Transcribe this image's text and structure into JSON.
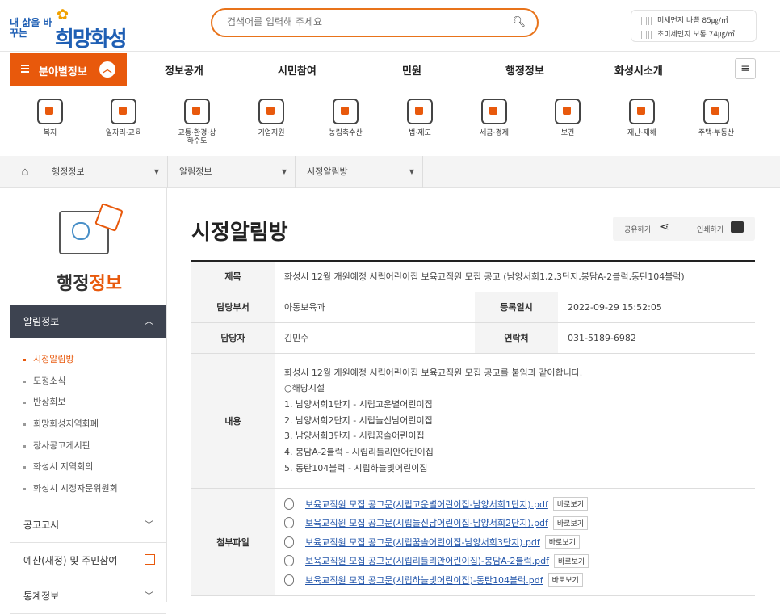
{
  "logo": {
    "small_text": "내 삶을 바꾸는",
    "big_text": "희망화성"
  },
  "search": {
    "placeholder": "검색어를 입력해 주세요"
  },
  "dust": {
    "pm10": "미세먼지 나쁨 85㎍/㎥",
    "pm25": "초미세먼지 보통 74㎍/㎥"
  },
  "nav": {
    "field_button": "분야별정보",
    "items": [
      "정보공개",
      "시민참여",
      "민원",
      "행정정보",
      "화성시소개"
    ]
  },
  "categories": [
    {
      "label": "복지",
      "icon": "handshake-icon"
    },
    {
      "label": "일자리·교육",
      "icon": "graduation-cap-icon"
    },
    {
      "label": "교통·환경·상하수도",
      "icon": "car-icon"
    },
    {
      "label": "기업지원",
      "icon": "businessman-icon"
    },
    {
      "label": "농림축수산",
      "icon": "farm-tools-icon"
    },
    {
      "label": "법·제도",
      "icon": "gavel-icon"
    },
    {
      "label": "세금·경제",
      "icon": "bar-chart-icon"
    },
    {
      "label": "보건",
      "icon": "first-aid-icon"
    },
    {
      "label": "재난·재해",
      "icon": "storm-cloud-icon"
    },
    {
      "label": "주택·부동산",
      "icon": "building-icon"
    }
  ],
  "breadcrumb": [
    "행정정보",
    "알림정보",
    "시정알림방"
  ],
  "sidebar": {
    "title_a": "행정",
    "title_b": "정보",
    "open_section": "알림정보",
    "sub_items": [
      "시정알림방",
      "도정소식",
      "반상회보",
      "희망화성지역화폐",
      "장사공고게시판",
      "화성시 지역회의",
      "화성시 시정자문위원회"
    ],
    "menus": [
      "공고고시",
      "예산(재정) 및 주민참여",
      "통계정보"
    ]
  },
  "page": {
    "title": "시정알림방",
    "share": "공유하기",
    "print": "인쇄하기"
  },
  "post": {
    "label_subject": "제목",
    "subject": "화성시 12월 개원예정 시립어린이집 보육교직원 모집 공고 (남양서희1,2,3단지,봉담A-2블럭,동탄104블럭)",
    "label_dept": "담당부서",
    "dept": "아동보육과",
    "label_date": "등록일시",
    "date": "2022-09-29 15:52:05",
    "label_person": "담당자",
    "person": "김민수",
    "label_contact": "연락처",
    "contact": "031-5189-6982",
    "label_content": "내용",
    "content_lines": [
      "화성시 12월 개원예정 시립어린이집 보육교직원 모집 공고를 붙임과 같이합니다.",
      "○해당시설",
      "1. 남양서희1단지 - 시립고운별어린이집",
      "2. 남양서희2단지 - 시립늘신남어린이집",
      "3. 남양서희3단지 - 시립꿈솔어린이집",
      "4. 봉담A-2블럭 - 시립리틀리안어린이집",
      "5. 동탄104블럭 - 시립하늘빛어린이집"
    ],
    "label_attach": "첨부파일",
    "view_label": "바로보기",
    "attachments": [
      "보육교직원 모집 공고문(시립고운별어린이집-남양서희1단지).pdf",
      "보육교직원 모집 공고문(시립늘신남어린이집-남양서희2단지).pdf",
      "보육교직원 모집 공고문(시립꿈솔어린이집-남양서희3단지).pdf",
      "보육교직원 모집 공고문(시립리틀리안어린이집)-봉담A-2블럭.pdf",
      "보육교직원 모집 공고문(시립하늘빛어린이집)-동탄104블럭.pdf"
    ]
  }
}
